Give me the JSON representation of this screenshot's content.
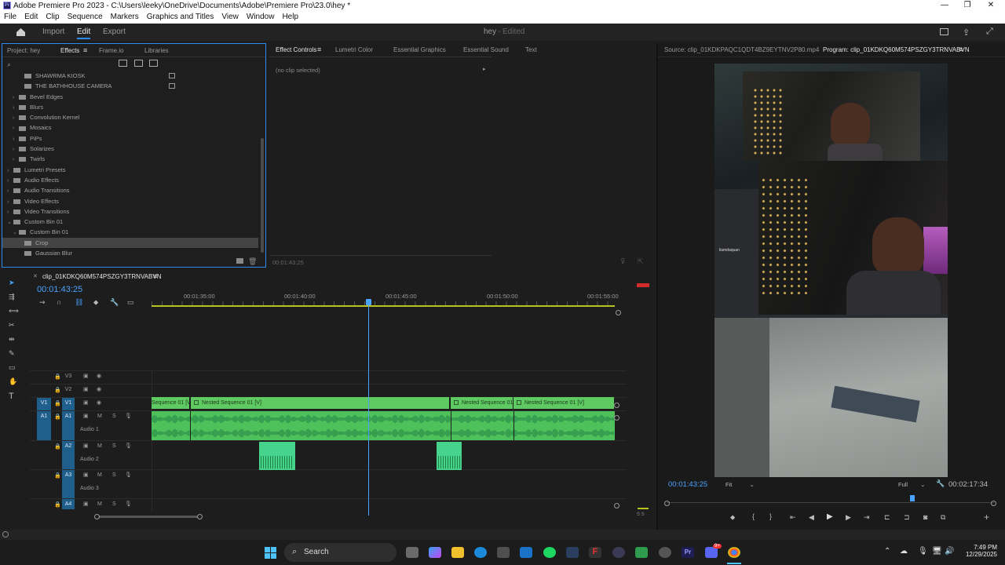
{
  "titlebar": {
    "title": "Adobe Premiere Pro 2023 - C:\\Users\\leeky\\OneDrive\\Documents\\Adobe\\Premiere Pro\\23.0\\hey *",
    "pr_icon": "Pr"
  },
  "menu": [
    "File",
    "Edit",
    "Clip",
    "Sequence",
    "Markers",
    "Graphics and Titles",
    "View",
    "Window",
    "Help"
  ],
  "workspace": {
    "home": "home-icon",
    "import": "Import",
    "edit": "Edit",
    "export": "Export",
    "project": "hey",
    "status": "Edited"
  },
  "leftpanel": {
    "tabs": [
      "Project: hey",
      "Effects",
      "Frame.io",
      "Libraries"
    ],
    "tree": [
      {
        "label": "SHAWRMA KIOSK",
        "indent": 2,
        "chev": ""
      },
      {
        "label": "THE BATHHOUSE CAMERA",
        "indent": 2,
        "chev": ""
      },
      {
        "label": "Bevel Edges",
        "indent": 1,
        "chev": "›"
      },
      {
        "label": "Blurs",
        "indent": 1,
        "chev": "›"
      },
      {
        "label": "Convolution Kernel",
        "indent": 1,
        "chev": "›"
      },
      {
        "label": "Mosaics",
        "indent": 1,
        "chev": "›"
      },
      {
        "label": "PiPs",
        "indent": 1,
        "chev": "›"
      },
      {
        "label": "Solarizes",
        "indent": 1,
        "chev": "›"
      },
      {
        "label": "Twirls",
        "indent": 1,
        "chev": "›"
      },
      {
        "label": "Lumetri Presets",
        "indent": 0,
        "chev": "›"
      },
      {
        "label": "Audio Effects",
        "indent": 0,
        "chev": "›"
      },
      {
        "label": "Audio Transitions",
        "indent": 0,
        "chev": "›"
      },
      {
        "label": "Video Effects",
        "indent": 0,
        "chev": "›"
      },
      {
        "label": "Video Transitions",
        "indent": 0,
        "chev": "›"
      },
      {
        "label": "Custom Bin 01",
        "indent": 0,
        "chev": "⌄"
      },
      {
        "label": "Custom Bin 01",
        "indent": 1,
        "chev": "⌄"
      },
      {
        "label": "Crop",
        "indent": 2,
        "chev": "",
        "selected": true
      },
      {
        "label": "Gaussian Blur",
        "indent": 2,
        "chev": ""
      }
    ]
  },
  "effectcontrols": {
    "tabs": [
      "Effect Controls",
      "Lumetri Color",
      "Essential Graphics",
      "Essential Sound",
      "Text"
    ],
    "empty": "(no clip selected)",
    "time": "00:01:43:25"
  },
  "program": {
    "source_tab": "Source: clip_01KDKPAQC1QDT4BZ9EYTNV2P80.mp4",
    "program_tab": "Program: clip_01KDKQ60M574PSZGY3TRNVABVN",
    "timecode": "00:01:43:25",
    "fit": "Fit",
    "quality": "Full",
    "duration": "00:02:17:34",
    "overlay_text": "liamdaquan",
    "playhead_fraction": 0.75
  },
  "timeline": {
    "sequence": "clip_01KDKQ60M574PSZGY3TRNVABVN",
    "timecode": "00:01:43:25",
    "ruler": [
      "00:01:35:00",
      "00:01:40:00",
      "00:01:45:00",
      "00:01:50:00",
      "00:01:55:00"
    ],
    "tracks": [
      {
        "id": "V3",
        "name": ""
      },
      {
        "id": "V2",
        "name": ""
      },
      {
        "id": "V1",
        "name": ""
      },
      {
        "id": "A1",
        "name": "Audio 1"
      },
      {
        "id": "A2",
        "name": "Audio 2"
      },
      {
        "id": "A3",
        "name": "Audio 3"
      },
      {
        "id": "A4",
        "name": ""
      }
    ],
    "src_v1": "V1",
    "src_a1": "A1",
    "clips": [
      "Sequence 01 [V]",
      "Nested Sequence 01 [V]",
      "Nested Sequence 01 [",
      "Nested Sequence 01 [V]"
    ],
    "track_btns": {
      "m": "M",
      "s": "S"
    },
    "meter_ss": "S S"
  },
  "taskbar": {
    "search": "Search",
    "time": "7:49 PM",
    "date": "12/29/2025",
    "badge": "9+"
  },
  "colors": {
    "accent": "#2d8ceb",
    "clip_video": "#5fc962",
    "clip_audio": "#4ec15a",
    "audio_sel": "#46d38c"
  }
}
